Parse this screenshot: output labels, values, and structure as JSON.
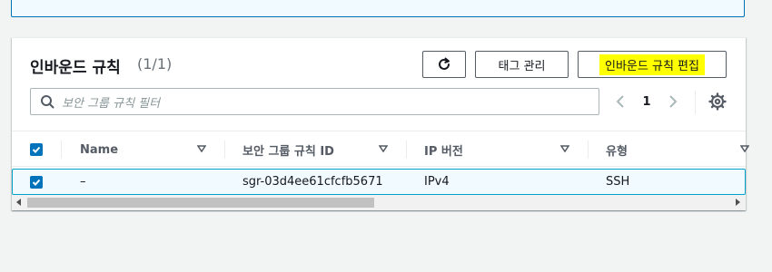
{
  "card": {
    "title": "인바운드 규칙",
    "count": "(1/1)"
  },
  "toolbar": {
    "refresh_icon": "refresh-icon",
    "tag_label": "태그 관리",
    "edit_label": "인바운드 규칙 편집",
    "edit_highlight_color": "#ffff00"
  },
  "search": {
    "placeholder": "보안 그룹 규칙 필터"
  },
  "pager": {
    "current_page": "1"
  },
  "table": {
    "columns": [
      {
        "label": "Name"
      },
      {
        "label": "보안 그룹 규칙 ID"
      },
      {
        "label": "IP 버전"
      },
      {
        "label": "유형"
      }
    ],
    "rows": [
      {
        "selected": true,
        "name": "–",
        "rule_id": "sgr-03d4ee61cfcfb5671",
        "ip_version": "IPv4",
        "type": "SSH"
      }
    ]
  },
  "colors": {
    "accent": "#0073bb",
    "selected_row_bg": "#f1faff",
    "selected_row_border": "#00a1c9"
  }
}
